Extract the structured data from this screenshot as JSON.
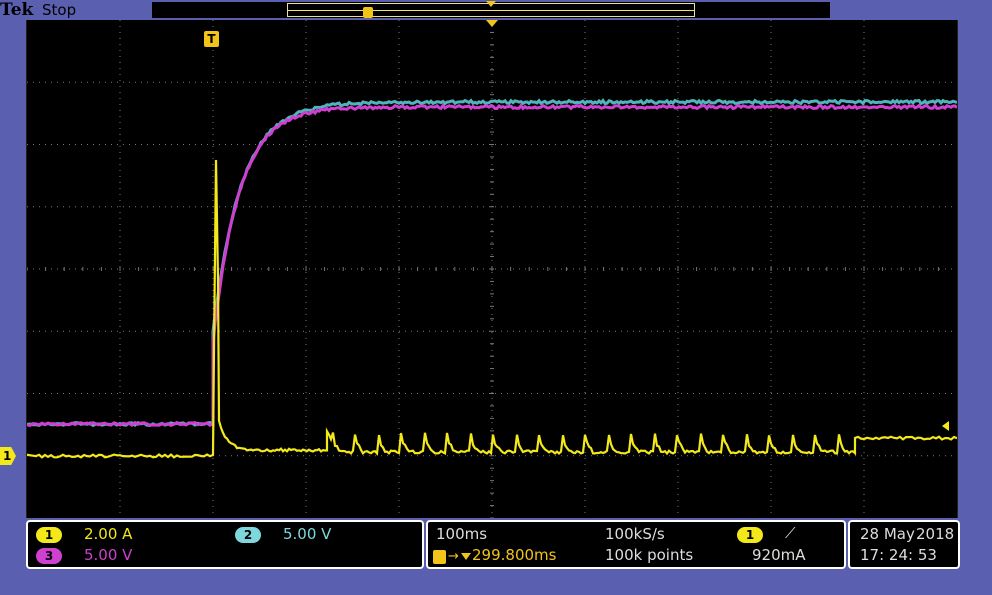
{
  "header": {
    "brand": "Tek",
    "state": "Stop"
  },
  "markers": {
    "trigger_glyph": "T",
    "record_trigger_glyph": "U",
    "ch1_glyph": "1"
  },
  "channels": {
    "ch1": {
      "number": "1",
      "scale": "2.00 A",
      "color": "#f2e81a"
    },
    "ch2": {
      "number": "2",
      "scale": "5.00 V",
      "color": "#7fd7de"
    },
    "ch3": {
      "number": "3",
      "scale": "5.00 V",
      "color": "#cf3fd0"
    }
  },
  "timebase": {
    "horizontal_scale": "100ms",
    "sample_rate": "100kS/s",
    "trigger_position": "299.800ms",
    "record_length": "100k points"
  },
  "trigger": {
    "source": "1",
    "slope_glyph": "⟋",
    "level": "920mA"
  },
  "datetime": {
    "date": "28 May",
    "year": "2018",
    "time": "17: 24: 53"
  },
  "colors": {
    "screen": "#000000",
    "frame": "#5a5fb0",
    "trigger_marker": "#f2c318",
    "grid": "#8a8a8a"
  }
}
